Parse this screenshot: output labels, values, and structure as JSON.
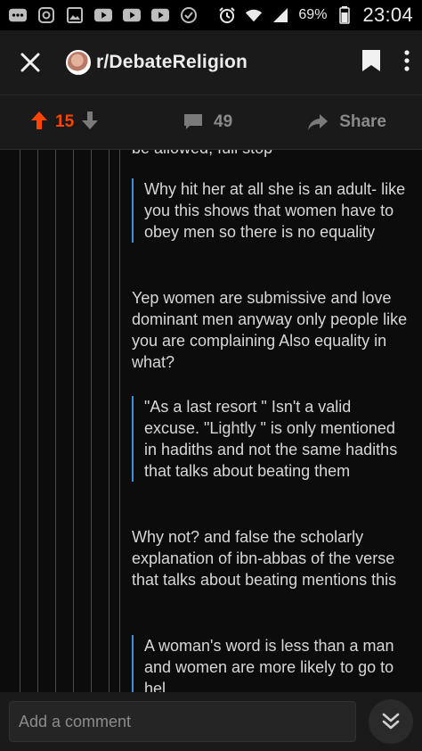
{
  "status_bar": {
    "battery": "69%",
    "time": "23:04",
    "left_icons": [
      "more-dots-icon",
      "instagram-icon",
      "gallery-icon",
      "youtube-icon",
      "youtube-icon",
      "youtube-icon",
      "check-circle-icon"
    ],
    "right_icons": [
      "alarm-icon",
      "wifi-icon",
      "signal-icon"
    ]
  },
  "header": {
    "subreddit": "r/DebateReligion"
  },
  "vote_bar": {
    "score": "15",
    "comments": "49",
    "share_label": "Share",
    "score_color": "#ff4500"
  },
  "thread": {
    "cut_text": "be allowed, full stop",
    "items": [
      {
        "type": "quote",
        "text": "Why hit her at all she is an adult- like you this shows that women have to obey men so there is no equality"
      },
      {
        "type": "para",
        "text": "Yep women are submissive and love dominant men anyway only people like you are complaining Also equality in what?"
      },
      {
        "type": "quote",
        "text": "\"As a last resort \" Isn't a valid excuse. \"Lightly \" is only mentioned in hadiths and not the same hadiths that talks about beating them"
      },
      {
        "type": "para",
        "text": "Why not? and false the scholarly explanation of ibn-abbas of the verse that talks about beating mentions this"
      },
      {
        "type": "quote",
        "text": "A woman's word is less than a man and women are more likely to go to hel"
      }
    ],
    "quote_color": "#3d8fe0"
  },
  "composer": {
    "placeholder": "Add a comment"
  }
}
